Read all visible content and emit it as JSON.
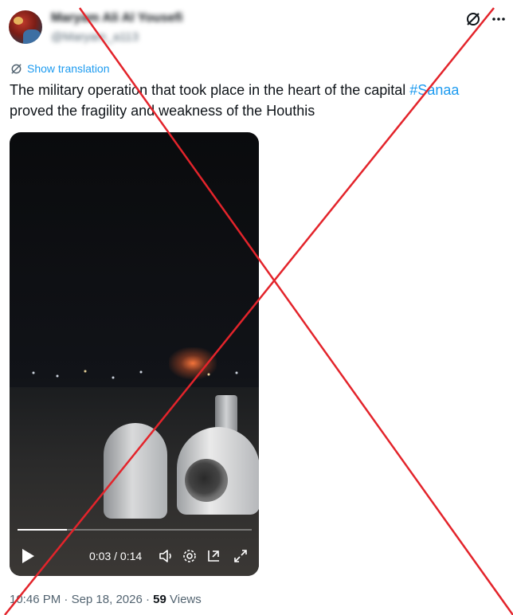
{
  "author": {
    "display_name": "Maryam Ali Al Yousefi",
    "handle": "@Maryam_a113"
  },
  "translate_label": "Show translation",
  "tweet": {
    "text_before": "The military operation that took place in the heart of the capital ",
    "hashtag": "#Sanaa",
    "text_after": " proved the fragility and weakness of the Houthis"
  },
  "video": {
    "current_time": "0:03",
    "duration": "0:14",
    "time_display": "0:03 / 0:14",
    "progress": 0.21
  },
  "meta": {
    "time": "10:46 PM",
    "separator": "·",
    "date": "Sep 18, 2026",
    "views_count": "59",
    "views_label": "Views"
  },
  "colors": {
    "link": "#1d9bf0",
    "text": "#0f1419",
    "secondary": "#536471",
    "overlay_cross": "#e3242b"
  },
  "icons": [
    "grok-icon",
    "more-icon",
    "translate-icon",
    "play-icon",
    "volume-icon",
    "settings-icon",
    "pip-icon",
    "fullscreen-icon"
  ]
}
